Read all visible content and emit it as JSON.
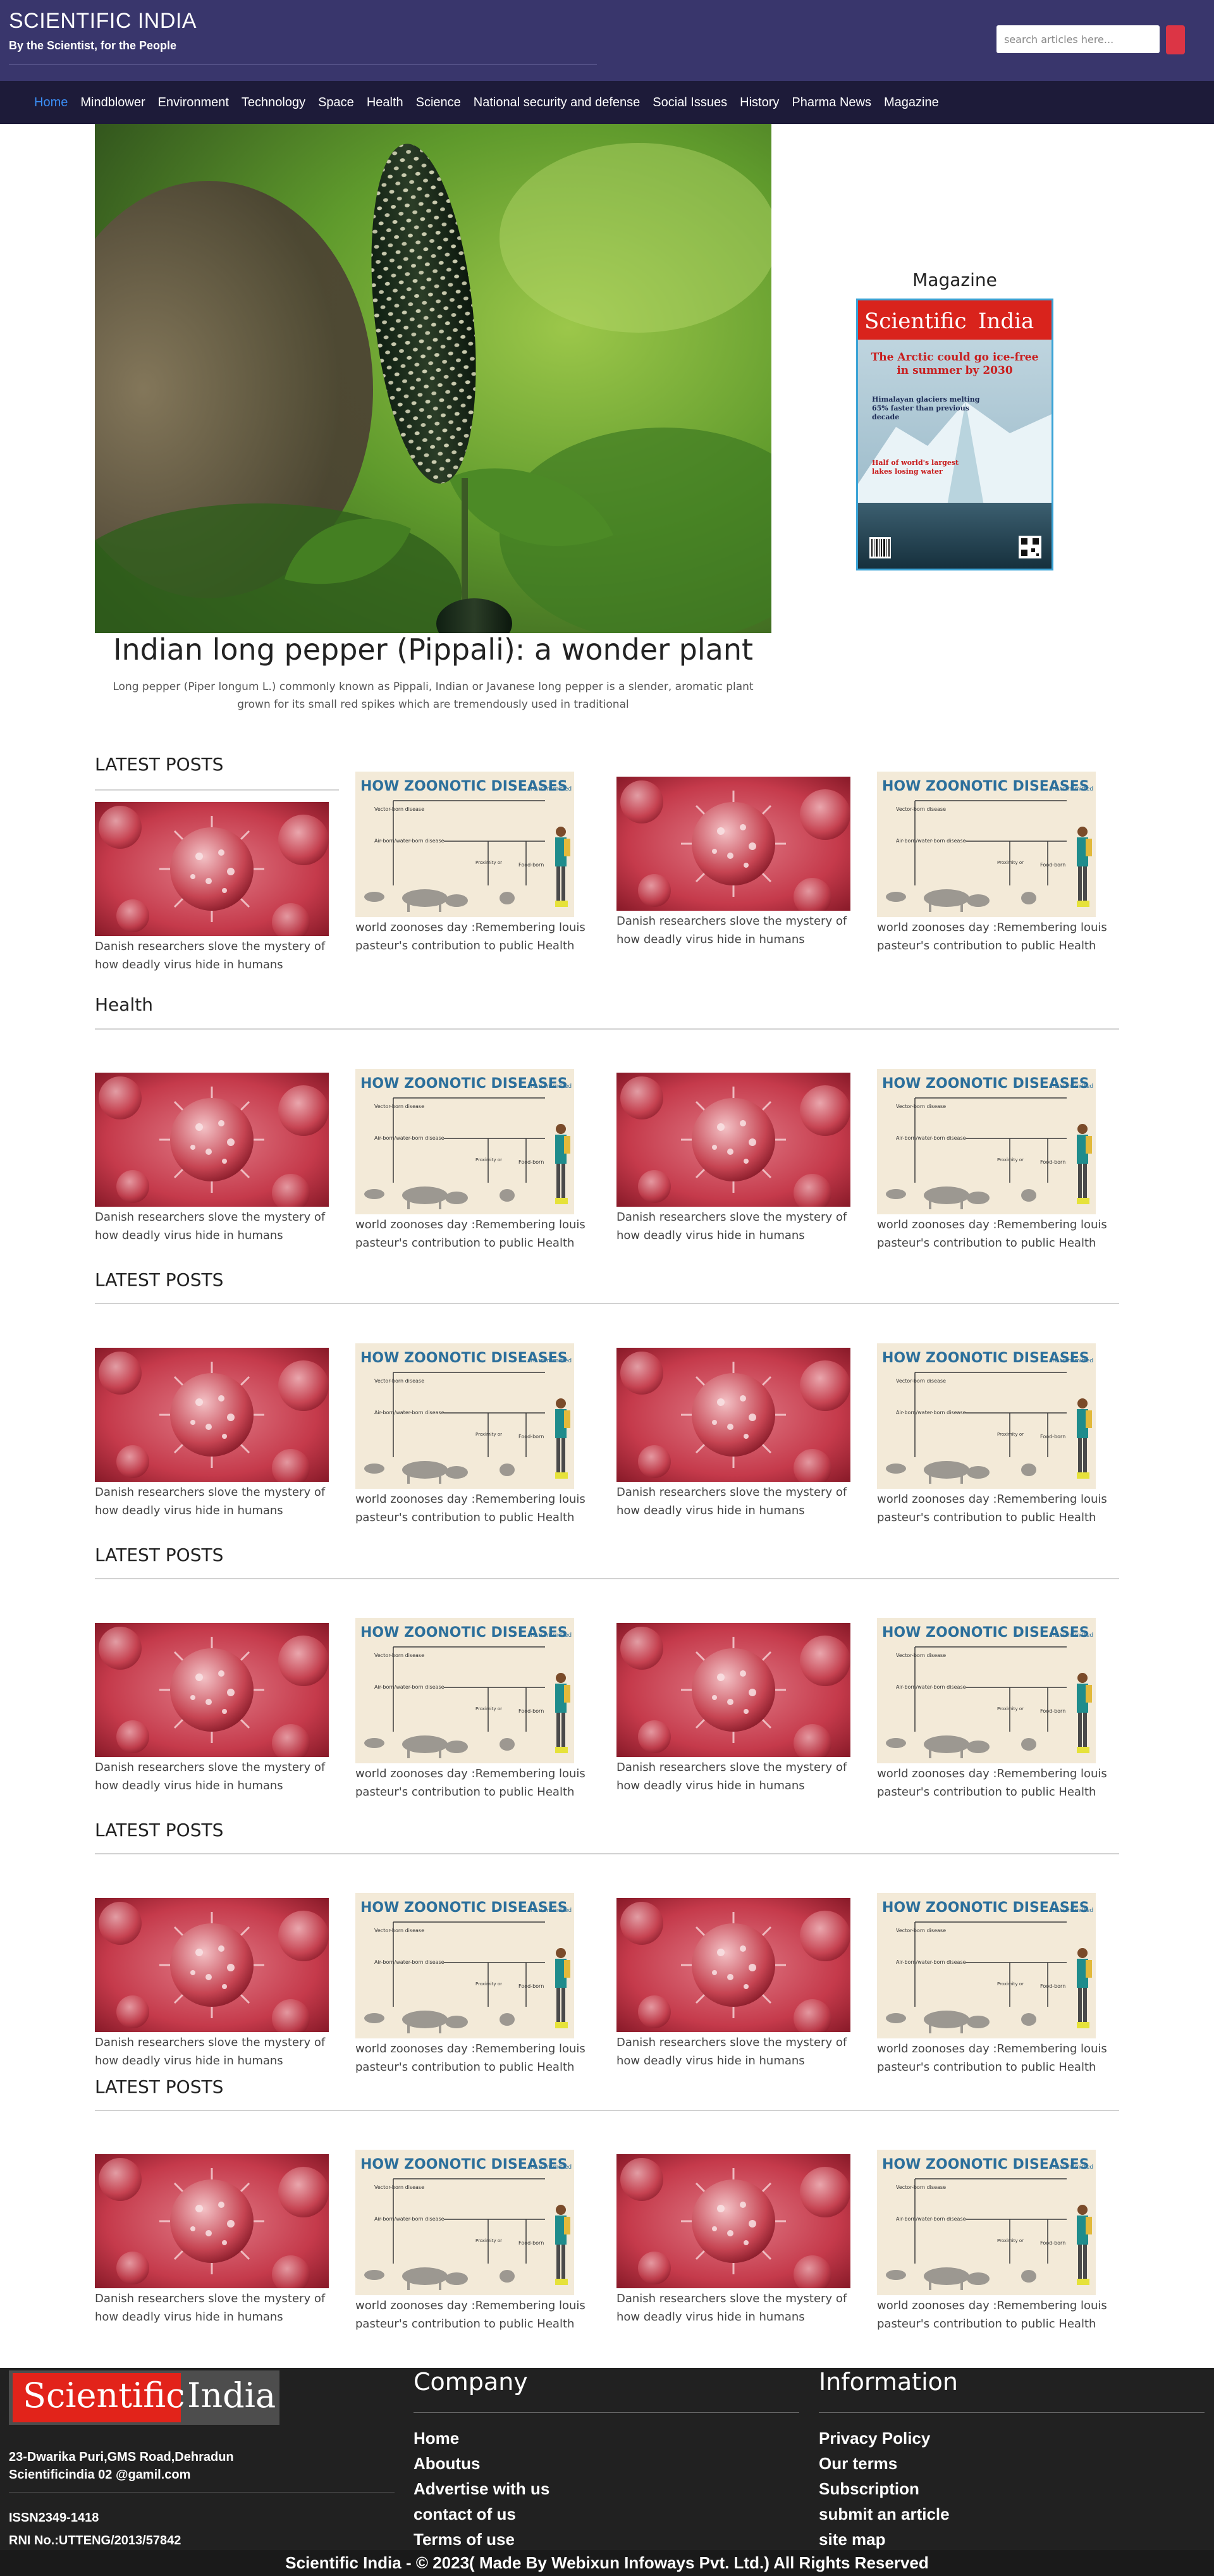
{
  "header": {
    "title": "SCIENTIFIC INDIA",
    "tagline": "By the Scientist, for the People",
    "search_placeholder": "search articles here...",
    "colors": {
      "header_bg": "#39366c",
      "nav_bg": "#1d1b39",
      "active_link": "#3b8ef5",
      "search_button": "#dc3545"
    }
  },
  "nav": {
    "items": [
      {
        "label": "Home",
        "active": true
      },
      {
        "label": "Mindblower"
      },
      {
        "label": "Environment"
      },
      {
        "label": "Technology"
      },
      {
        "label": "Space"
      },
      {
        "label": "Health"
      },
      {
        "label": "Science"
      },
      {
        "label": "National security and defense"
      },
      {
        "label": "Social Issues"
      },
      {
        "label": "History"
      },
      {
        "label": "Pharma News"
      },
      {
        "label": "Magazine"
      }
    ]
  },
  "hero": {
    "title": "Indian long pepper (Pippali): a wonder plant",
    "description": "Long pepper (Piper longum L.) commonly known as Pippali, Indian or Javanese long pepper is a slender, aromatic plant grown for its small red spikes which are tremendously used in traditional"
  },
  "magazine": {
    "title": "Magazine",
    "cover": {
      "brand_left": "Scientific",
      "brand_right": "India",
      "headline": "The Arctic could go ice-free in summer by 2030",
      "sub1": "Himalayan glaciers melting 65% faster than previous decade",
      "sub2": "Half of world's largest lakes losing water"
    }
  },
  "sections": [
    {
      "title": "LATEST POSTS",
      "cards": [
        {
          "type": "virus",
          "caption": "Danish researchers slove the mystery of how deadly virus hide in humans"
        },
        {
          "type": "zoonotic",
          "caption": "world zoonoses day :Remembering louis pasteur's contribution to public Health"
        },
        {
          "type": "virus",
          "caption": "Danish researchers slove the mystery of how deadly virus hide in humans"
        },
        {
          "type": "zoonotic",
          "caption": "world zoonoses day :Remembering louis pasteur's contribution to public Health"
        }
      ]
    },
    {
      "title": "Health",
      "cards": [
        {
          "type": "virus",
          "caption": "Danish researchers slove the mystery of how deadly virus hide in humans"
        },
        {
          "type": "zoonotic",
          "caption": "world zoonoses day :Remembering louis pasteur's contribution to public Health"
        },
        {
          "type": "virus",
          "caption": "Danish researchers slove the mystery of how deadly virus hide in humans"
        },
        {
          "type": "zoonotic",
          "caption": "world zoonoses day :Remembering louis pasteur's contribution to public Health"
        }
      ]
    },
    {
      "title": "LATEST POSTS",
      "cards": [
        {
          "type": "virus",
          "caption": "Danish researchers slove the mystery of how deadly virus hide in humans"
        },
        {
          "type": "zoonotic",
          "caption": "world zoonoses day :Remembering louis pasteur's contribution to public Health"
        },
        {
          "type": "virus",
          "caption": "Danish researchers slove the mystery of how deadly virus hide in humans"
        },
        {
          "type": "zoonotic",
          "caption": "world zoonoses day :Remembering louis pasteur's contribution to public Health"
        }
      ]
    },
    {
      "title": "LATEST POSTS",
      "cards": [
        {
          "type": "virus",
          "caption": "Danish researchers slove the mystery of how deadly virus hide in humans"
        },
        {
          "type": "zoonotic",
          "caption": "world zoonoses day :Remembering louis pasteur's contribution to public Health"
        },
        {
          "type": "virus",
          "caption": "Danish researchers slove the mystery of how deadly virus hide in humans"
        },
        {
          "type": "zoonotic",
          "caption": "world zoonoses day :Remembering louis pasteur's contribution to public Health"
        }
      ]
    },
    {
      "title": "LATEST POSTS",
      "cards": [
        {
          "type": "virus",
          "caption": "Danish researchers slove the mystery of how deadly virus hide in humans"
        },
        {
          "type": "zoonotic",
          "caption": "world zoonoses day :Remembering louis pasteur's contribution to public Health"
        },
        {
          "type": "virus",
          "caption": "Danish researchers slove the mystery of how deadly virus hide in humans"
        },
        {
          "type": "zoonotic",
          "caption": "world zoonoses day :Remembering louis pasteur's contribution to public Health"
        }
      ]
    },
    {
      "title": "LATEST POSTS",
      "cards": [
        {
          "type": "virus",
          "caption": "Danish researchers slove the mystery of how deadly virus hide in humans"
        },
        {
          "type": "zoonotic",
          "caption": "world zoonoses day :Remembering louis pasteur's contribution to public Health"
        },
        {
          "type": "virus",
          "caption": "Danish researchers slove the mystery of how deadly virus hide in humans"
        },
        {
          "type": "zoonotic",
          "caption": "world zoonoses day :Remembering louis pasteur's contribution to public Health"
        }
      ]
    }
  ],
  "zoonotic_image": {
    "heading_bold": "HOW ZOONOTIC DISEASES",
    "heading_small": "are transmitted",
    "labels": [
      "Vector-born disease",
      "Air-born/water-born disease",
      "Proximity or direct contact to animals",
      "Food-born"
    ]
  },
  "footer": {
    "logo_left": "Scientific",
    "logo_right": "India",
    "address": "23-Dwarika Puri,GMS Road,Dehradun",
    "email": "Scientificindia 02 @gamil.com",
    "issn": "ISSN2349-1418",
    "rni": "RNI No.:UTTENG/2013/57842",
    "company": {
      "title": "Company",
      "links": [
        "Home",
        "Aboutus",
        "Advertise with us",
        "contact of us",
        "Terms of use"
      ]
    },
    "information": {
      "title": "Information",
      "links": [
        "Privacy Policy",
        "Our terms",
        "Subscription",
        "submit an article",
        "site map"
      ]
    },
    "copyright": "Scientific India - © 2023( Made By Webixun Infoways Pvt. Ltd.) All Rights Reserved"
  }
}
